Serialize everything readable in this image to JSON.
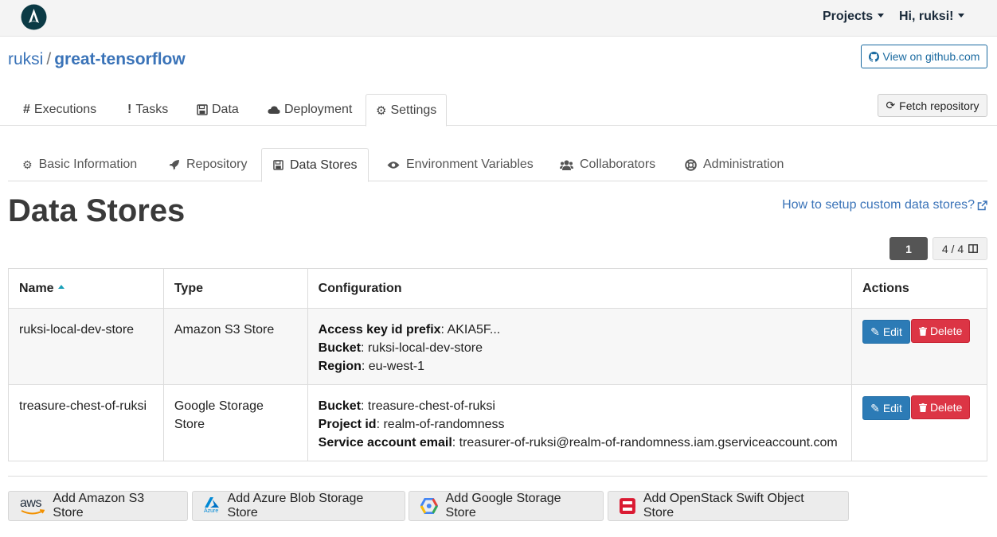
{
  "nav": {
    "projects_label": "Projects",
    "user_label": "Hi, ruksi!"
  },
  "repo": {
    "owner": "ruksi",
    "separator": "/",
    "name": "great-tensorflow",
    "github_button": "View on github.com",
    "fetch_button": "Fetch repository"
  },
  "main_tabs": [
    {
      "label": "Executions",
      "icon": "hash-icon"
    },
    {
      "label": "Tasks",
      "icon": "exclamation-icon"
    },
    {
      "label": "Data",
      "icon": "floppy-icon"
    },
    {
      "label": "Deployment",
      "icon": "cloud-icon"
    },
    {
      "label": "Settings",
      "icon": "gear-icon",
      "active": true
    }
  ],
  "sub_tabs": [
    {
      "label": "Basic Information",
      "icon": "cogs-icon"
    },
    {
      "label": "Repository",
      "icon": "rocket-icon"
    },
    {
      "label": "Data Stores",
      "icon": "floppy-icon",
      "active": true
    },
    {
      "label": "Environment Variables",
      "icon": "eye-icon"
    },
    {
      "label": "Collaborators",
      "icon": "users-icon"
    },
    {
      "label": "Administration",
      "icon": "lifebuoy-icon"
    }
  ],
  "page": {
    "title": "Data Stores",
    "help_link": "How to setup custom data stores?"
  },
  "pager": {
    "current_page": "1",
    "columns": "4 / 4"
  },
  "table": {
    "headers": {
      "name": "Name",
      "type": "Type",
      "configuration": "Configuration",
      "actions": "Actions"
    },
    "edit_label": "Edit",
    "delete_label": "Delete",
    "rows": [
      {
        "name": "ruksi-local-dev-store",
        "type": "Amazon S3 Store",
        "config": [
          {
            "key": "Access key id prefix",
            "value": ": AKIA5F..."
          },
          {
            "key": "Bucket",
            "value": ": ruksi-local-dev-store"
          },
          {
            "key": "Region",
            "value": ": eu-west-1"
          }
        ]
      },
      {
        "name": "treasure-chest-of-ruksi",
        "type": "Google Storage Store",
        "config": [
          {
            "key": "Bucket",
            "value": ": treasure-chest-of-ruksi"
          },
          {
            "key": "Project id",
            "value": ": realm-of-randomness"
          },
          {
            "key": "Service account email",
            "value": ": treasurer-of-ruksi@realm-of-randomness.iam.gserviceaccount.com"
          }
        ]
      }
    ]
  },
  "add_buttons": [
    {
      "label": "Add Amazon S3 Store",
      "icon": "aws-icon",
      "icon_text": "aws"
    },
    {
      "label": "Add Azure Blob Storage Store",
      "icon": "azure-icon",
      "icon_text": "Azure"
    },
    {
      "label": "Add Google Storage Store",
      "icon": "google-cloud-icon"
    },
    {
      "label": "Add OpenStack Swift Object Store",
      "icon": "openstack-icon"
    }
  ],
  "colors": {
    "link_blue": "#3a73b8",
    "edit_blue": "#2c7bb6",
    "delete_red": "#dc3545",
    "logo_teal": "#0b3a45"
  }
}
